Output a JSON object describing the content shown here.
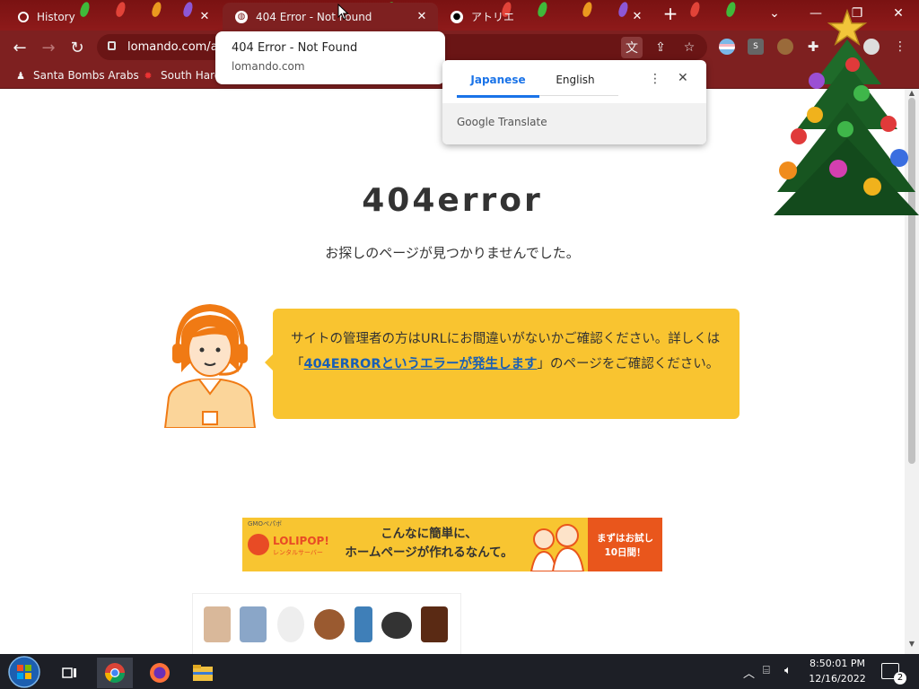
{
  "browser": {
    "tabs": [
      {
        "title": "History",
        "icon": "history-icon"
      },
      {
        "title": "404 Error - Not Found",
        "icon": "globe-icon",
        "active": true
      },
      {
        "title": "アトリエ",
        "icon": "panda-icon"
      }
    ],
    "new_tab_symbol": "+",
    "window_controls": {
      "tab_search": "⌄",
      "minimize": "—",
      "maximize": "❐",
      "close": "✕"
    },
    "omnibox": {
      "url": "lomando.com/a"
    },
    "bookmarks": [
      {
        "label": "Santa Bombs Arabs",
        "icon": "santa-icon"
      },
      {
        "label": "South Hard",
        "icon": "maple-leaf-icon"
      }
    ],
    "theme_colors": {
      "frame": "#7e2020",
      "accent_blue": "#1a73e8"
    }
  },
  "tab_tooltip": {
    "title": "404 Error - Not Found",
    "domain": "lomando.com"
  },
  "translate_popup": {
    "tabs": [
      "Japanese",
      "English"
    ],
    "selected": "Japanese",
    "footer": "Google Translate"
  },
  "page": {
    "title": "404error",
    "subtitle": "お探しのページが見つかりませんでした。",
    "message_before_link": "サイトの管理者の方はURLにお間違いがないかご確認ください。詳しくは「",
    "message_link": "404ERRORというエラーが発生します",
    "message_after_link": "」のページをご確認ください。",
    "ad_banner": {
      "provider": "GMOペパボ",
      "logo": "LOLIPOP!",
      "logo_sub": "レンタルサーバー",
      "copy_line1": "こんなに簡単に、",
      "copy_line2": "ホームページが作れるなんて。",
      "cta_line1": "まずはお試し",
      "cta_line2": "10日間！",
      "cta_color": "#e9561c"
    },
    "bubble_color": "#f9c430"
  },
  "taskbar": {
    "apps": [
      "windows-start-icon",
      "task-view-icon",
      "chrome-icon",
      "firefox-icon",
      "file-explorer-icon"
    ],
    "clock_time": "8:50:01 PM",
    "clock_date": "12/16/2022",
    "notification_count": "2"
  }
}
